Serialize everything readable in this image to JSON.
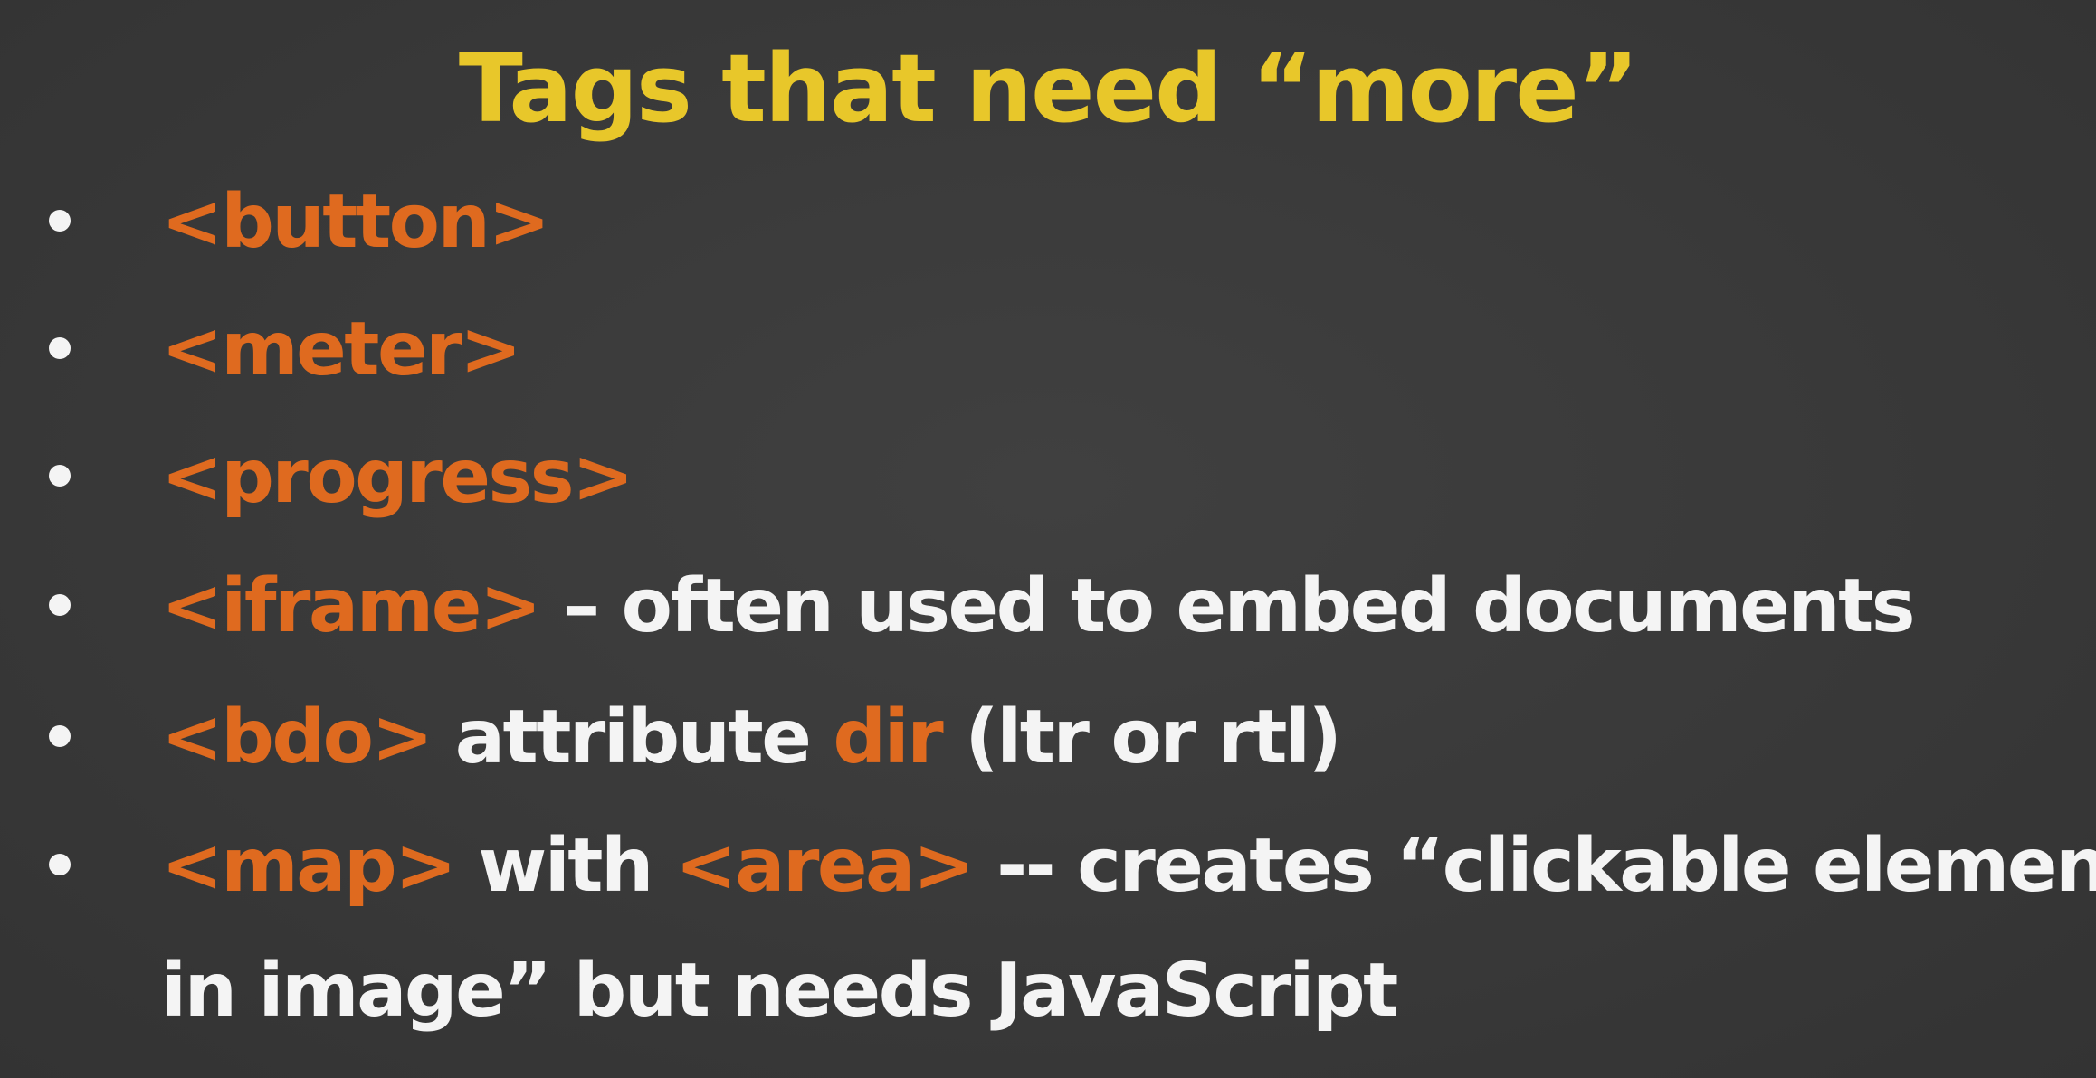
{
  "slide": {
    "title": "Tags that need “more”",
    "bullets": [
      {
        "tag": "<button>"
      },
      {
        "tag": "<meter>"
      },
      {
        "tag": "<progress>"
      },
      {
        "tag": "<iframe>",
        "text": " – often used to embed documents"
      },
      {
        "tag": "<bdo>",
        "text": " attribute ",
        "tag2": "dir",
        "text2": " (ltr or rtl)"
      },
      {
        "tag": "<map>",
        "text": " with ",
        "tag2": "<area>",
        "text2": " -- creates “clickable element",
        "line2": "in image” but needs JavaScript"
      }
    ]
  },
  "colors": {
    "background": "#3b3b3b",
    "title": "#e8c72a",
    "tag": "#df6a1f",
    "text": "#f4f4f4"
  }
}
